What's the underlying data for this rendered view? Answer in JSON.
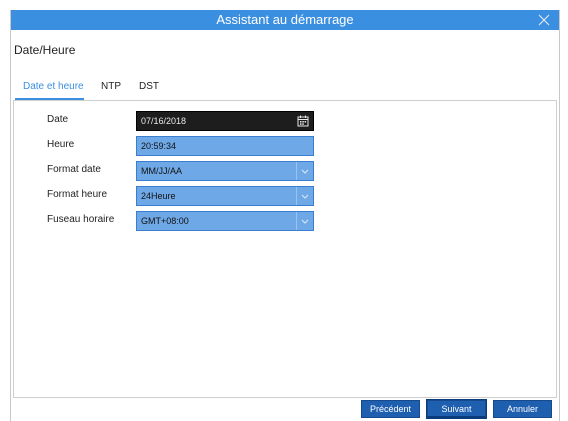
{
  "window": {
    "title": "Assistant au démarrage"
  },
  "section": {
    "title": "Date/Heure"
  },
  "tabs": [
    {
      "label": "Date et heure",
      "active": true
    },
    {
      "label": "NTP",
      "active": false
    },
    {
      "label": "DST",
      "active": false
    }
  ],
  "form": {
    "date": {
      "label": "Date",
      "value": "07/16/2018"
    },
    "time": {
      "label": "Heure",
      "value": "20:59:34"
    },
    "date_format": {
      "label": "Format date",
      "value": "MM/JJ/AA"
    },
    "time_format": {
      "label": "Format heure",
      "value": "24Heure"
    },
    "timezone": {
      "label": "Fuseau horaire",
      "value": "GMT+08:00"
    }
  },
  "footer": {
    "previous_label": "Précédent",
    "next_label": "Suivant",
    "cancel_label": "Annuler"
  },
  "icons": {
    "close": "close-icon",
    "calendar": "calendar-icon",
    "dropdown": "chevron-down-icon"
  },
  "colors": {
    "accent": "#3b8fe0",
    "field_fill": "#6fa8e6",
    "button_fill": "#1f5fb0"
  }
}
